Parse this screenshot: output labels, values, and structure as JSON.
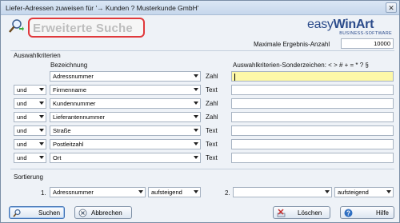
{
  "window": {
    "title": "Liefer-Adressen zuweisen für  '→ Kunden ? Musterkunde GmbH'",
    "close_glyph": "✕"
  },
  "header": {
    "search_title": "Erweiterte Suche",
    "logo_text_1": "easy",
    "logo_text_2": "WinArt",
    "logo_tagline": "BUSINESS-SOFTWARE",
    "max_results_label": "Maximale Ergebnis-Anzahl",
    "max_results_value": "10000"
  },
  "criteria": {
    "section_label": "Auswahlkriterien",
    "col_bezeichnung": "Bezeichnung",
    "col_special": "Auswahlkriterien-Sonderzeichen:  < > # + = * ? §",
    "rows": [
      {
        "connector": "",
        "field": "Adressnummer",
        "type": "Zahl",
        "value": ""
      },
      {
        "connector": "und",
        "field": "Firmenname",
        "type": "Text",
        "value": ""
      },
      {
        "connector": "und",
        "field": "Kundennummer",
        "type": "Zahl",
        "value": ""
      },
      {
        "connector": "und",
        "field": "Lieferantennummer",
        "type": "Zahl",
        "value": ""
      },
      {
        "connector": "und",
        "field": "Straße",
        "type": "Text",
        "value": ""
      },
      {
        "connector": "und",
        "field": "Postleitzahl",
        "type": "Text",
        "value": ""
      },
      {
        "connector": "und",
        "field": "Ort",
        "type": "Text",
        "value": ""
      }
    ]
  },
  "sorting": {
    "section_label": "Sortierung",
    "n1": "1.",
    "field1": "Adressnummer",
    "order1": "aufsteigend",
    "n2": "2.",
    "field2": "",
    "order2": "aufsteigend"
  },
  "buttons": {
    "search": "Suchen",
    "cancel": "Abbrechen",
    "delete": "Löschen",
    "help": "Hilfe"
  },
  "colors": {
    "highlight_border": "#e0393c",
    "active_field": "#fdf8a8",
    "brand": "#2a4a8a"
  }
}
